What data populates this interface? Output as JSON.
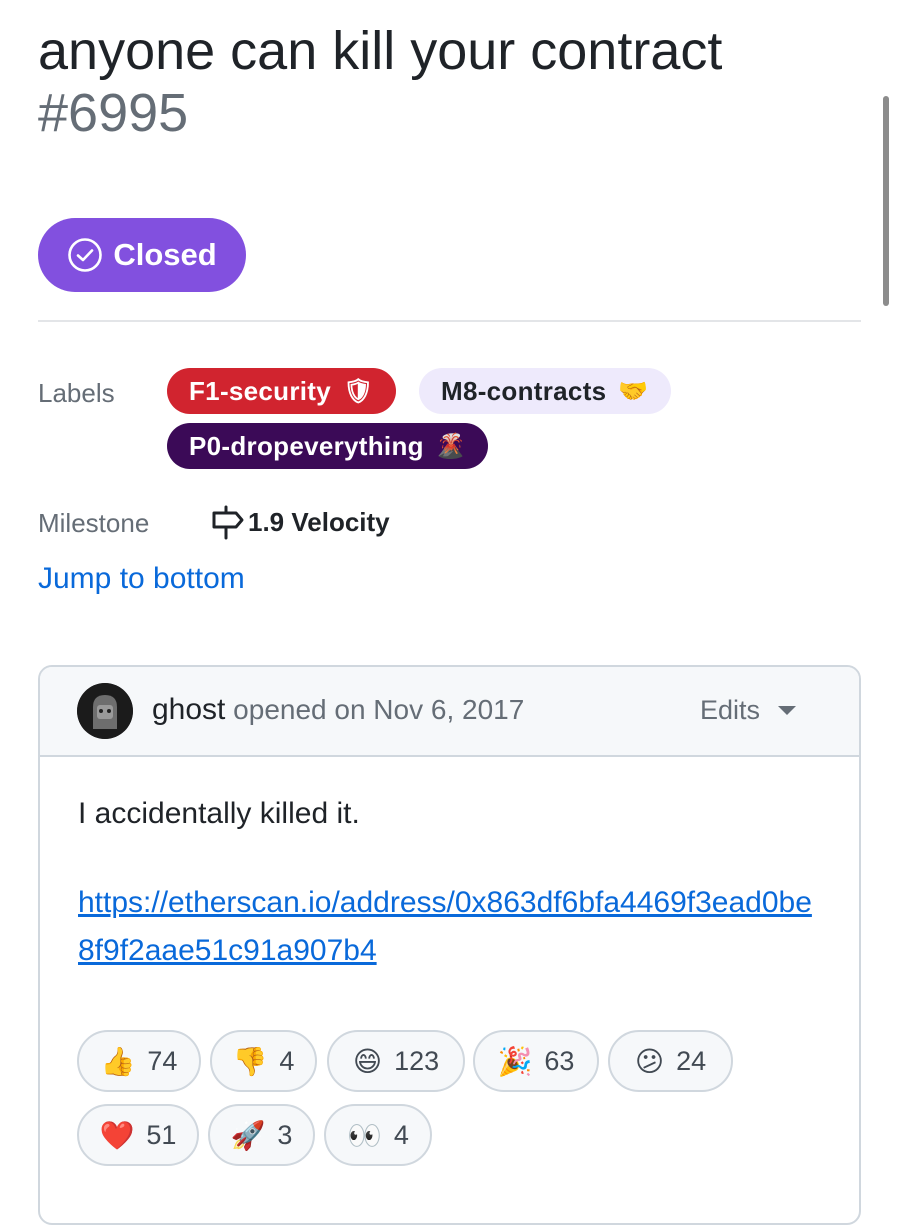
{
  "issue": {
    "title": "anyone can kill your contract",
    "number": "#6995",
    "state": "Closed"
  },
  "labels_heading": "Labels",
  "labels": [
    {
      "text": "F1-security",
      "emoji": "🛡",
      "bg": "#d1242f",
      "fg": "#ffffff"
    },
    {
      "text": "M8-contracts",
      "emoji": "🤝",
      "bg": "#eeeafc",
      "fg": "#1f2328"
    },
    {
      "text": "P0-dropeverything",
      "emoji": "🌋",
      "bg": "#3b0a57",
      "fg": "#ffffff"
    }
  ],
  "milestone_heading": "Milestone",
  "milestone": "1.9 Velocity",
  "jump_link": "Jump to bottom",
  "comment": {
    "author": "ghost",
    "action": "opened on Nov 6, 2017",
    "edits_label": "Edits",
    "body": "I accidentally killed it.",
    "link": "https://etherscan.io/address/0x863df6bfa4469f3ead0be8f9f2aae51c91a907b4"
  },
  "reactions": [
    {
      "emoji": "👍",
      "count": "74"
    },
    {
      "emoji": "👎",
      "count": "4"
    },
    {
      "emoji": "😄",
      "count": "123"
    },
    {
      "emoji": "🎉",
      "count": "63"
    },
    {
      "emoji": "😕",
      "count": "24"
    },
    {
      "emoji": "❤️",
      "count": "51"
    },
    {
      "emoji": "🚀",
      "count": "3"
    },
    {
      "emoji": "👀",
      "count": "4"
    }
  ],
  "colors": {
    "closed": "#8250df",
    "link": "#0969da"
  }
}
